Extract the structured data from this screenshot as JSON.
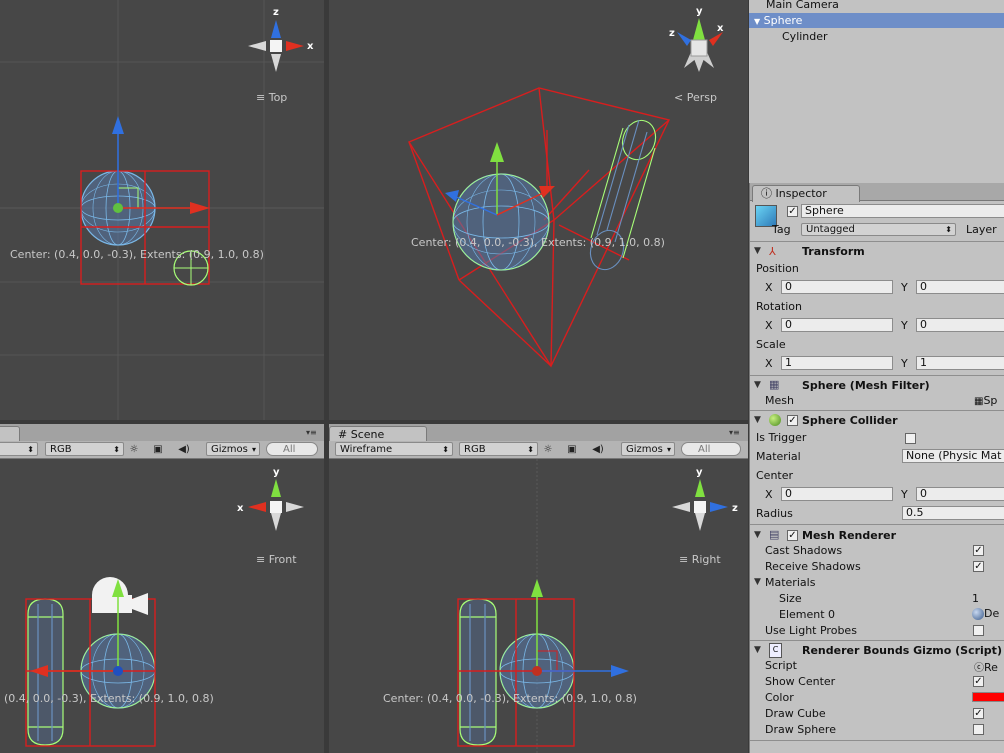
{
  "colors": {
    "bounds": "#d81e1e",
    "wire": "#7ab8e8",
    "collider": "#a8ff78",
    "axis_x": "#e03020",
    "axis_y": "#80e040",
    "axis_z": "#3070e0",
    "viewport_bg": "#474747",
    "selection": "#6e8ec8",
    "panel": "#c2c2c2"
  },
  "viewports": {
    "top": {
      "label": "Top",
      "center_text": "Center: (0.4, 0.0, -0.3), Extents: (0.9, 1.0, 0.8)",
      "gizmo": {
        "up": "z",
        "right": "x"
      }
    },
    "persp": {
      "label": "Persp",
      "center_text": "Center: (0.4, 0.0, -0.3), Extents: (0.9, 1.0, 0.8)",
      "gizmo": {
        "y": "y",
        "z": "z",
        "x": "x"
      }
    },
    "front": {
      "label": "Front",
      "center_text": "(0.4, 0.0, -0.3), Extents: (0.9, 1.0, 0.8)",
      "gizmo": {
        "up": "y",
        "left": "x"
      }
    },
    "right": {
      "label": "Right",
      "center_text": "Center: (0.4, 0.0, -0.3), Extents: (0.9, 1.0, 0.8)",
      "gizmo": {
        "up": "y",
        "right": "z"
      }
    }
  },
  "scene_tab": {
    "label": "Scene"
  },
  "toolbars": {
    "left": {
      "render_mode": "",
      "channel": "RGB",
      "gizmos": "Gizmos",
      "search_placeholder": "All"
    },
    "right": {
      "render_mode": "Wireframe",
      "channel": "RGB",
      "gizmos": "Gizmos",
      "search_placeholder": "All"
    }
  },
  "hierarchy": {
    "items": [
      {
        "label": "Main Camera",
        "indent": 1,
        "selected": false
      },
      {
        "label": "Sphere",
        "indent": 1,
        "selected": true
      },
      {
        "label": "Cylinder",
        "indent": 2,
        "selected": false
      }
    ]
  },
  "inspector": {
    "tab": "Inspector",
    "object_name": "Sphere",
    "tag_label": "Tag",
    "tag_value": "Untagged",
    "layer_label": "Layer",
    "transform": {
      "title": "Transform",
      "position_label": "Position",
      "rotation_label": "Rotation",
      "scale_label": "Scale",
      "x": "X",
      "y": "Y",
      "position": {
        "x": "0",
        "y": "0"
      },
      "rotation": {
        "x": "0",
        "y": "0"
      },
      "scale": {
        "x": "1",
        "y": "1"
      }
    },
    "mesh_filter": {
      "title": "Sphere (Mesh Filter)",
      "mesh_label": "Mesh",
      "mesh_value": "Sp"
    },
    "sphere_collider": {
      "title": "Sphere Collider",
      "is_trigger_label": "Is Trigger",
      "is_trigger": false,
      "material_label": "Material",
      "material_value": "None (Physic Mat",
      "center_label": "Center",
      "center": {
        "x": "0",
        "y": "0"
      },
      "radius_label": "Radius",
      "radius": "0.5"
    },
    "mesh_renderer": {
      "title": "Mesh Renderer",
      "cast_shadows_label": "Cast Shadows",
      "cast_shadows": true,
      "receive_shadows_label": "Receive Shadows",
      "receive_shadows": true,
      "materials_label": "Materials",
      "size_label": "Size",
      "size": "1",
      "element0_label": "Element 0",
      "element0_value": "De",
      "light_probes_label": "Use Light Probes",
      "light_probes": false
    },
    "gizmo_script": {
      "title": "Renderer Bounds Gizmo (Script)",
      "script_label": "Script",
      "script_value": "Re",
      "show_center_label": "Show Center",
      "show_center": true,
      "color_label": "Color",
      "color_value": "#ff0000",
      "draw_cube_label": "Draw Cube",
      "draw_cube": true,
      "draw_sphere_label": "Draw Sphere",
      "draw_sphere": false
    }
  }
}
